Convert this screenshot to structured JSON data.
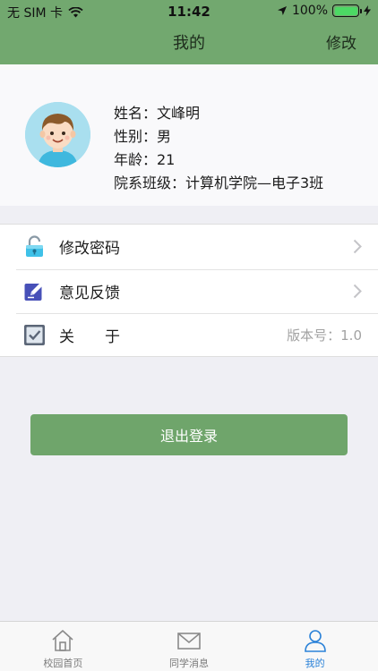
{
  "status_bar": {
    "carrier": "无 SIM 卡",
    "time": "11:42",
    "battery": "100%"
  },
  "nav": {
    "title": "我的",
    "edit_label": "修改"
  },
  "profile": {
    "name_row": "姓名：文峰明",
    "gender_row": "性别：男",
    "age_row": "年龄：21",
    "class_row": "院系班级：计算机学院—电子3班"
  },
  "menu": {
    "change_password": "修改密码",
    "feedback": "意见反馈",
    "about": "关　　于",
    "version": "版本号：1.0"
  },
  "logout_label": "退出登录",
  "tabs": [
    {
      "label": "校园首页",
      "icon": "home-icon"
    },
    {
      "label": "同学消息",
      "icon": "mail-icon"
    },
    {
      "label": "我的",
      "icon": "person-icon"
    }
  ],
  "colors": {
    "brand_green": "#72a86f",
    "tab_active": "#2b82d8",
    "battery_green": "#4cd964"
  }
}
